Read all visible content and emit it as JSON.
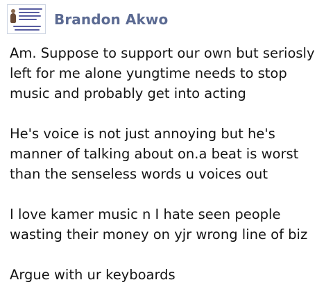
{
  "post": {
    "author": "Brandon Akwo",
    "paragraphs": [
      "Am. Suppose to support our own but seriosly\nleft for me alone yungtime needs to stop\nmusic and probably get into acting",
      "He's voice is not just annoying but he's\nmanner of talking about on.a beat is worst\nthan the senseless words u voices out",
      "I love kamer music n I hate seen people\nwasting their money on yjr wrong line of biz",
      "Argue with ur keyboards"
    ]
  },
  "colors": {
    "author_name": "#5b6a92",
    "body_text": "#141414",
    "background": "#ffffff"
  }
}
